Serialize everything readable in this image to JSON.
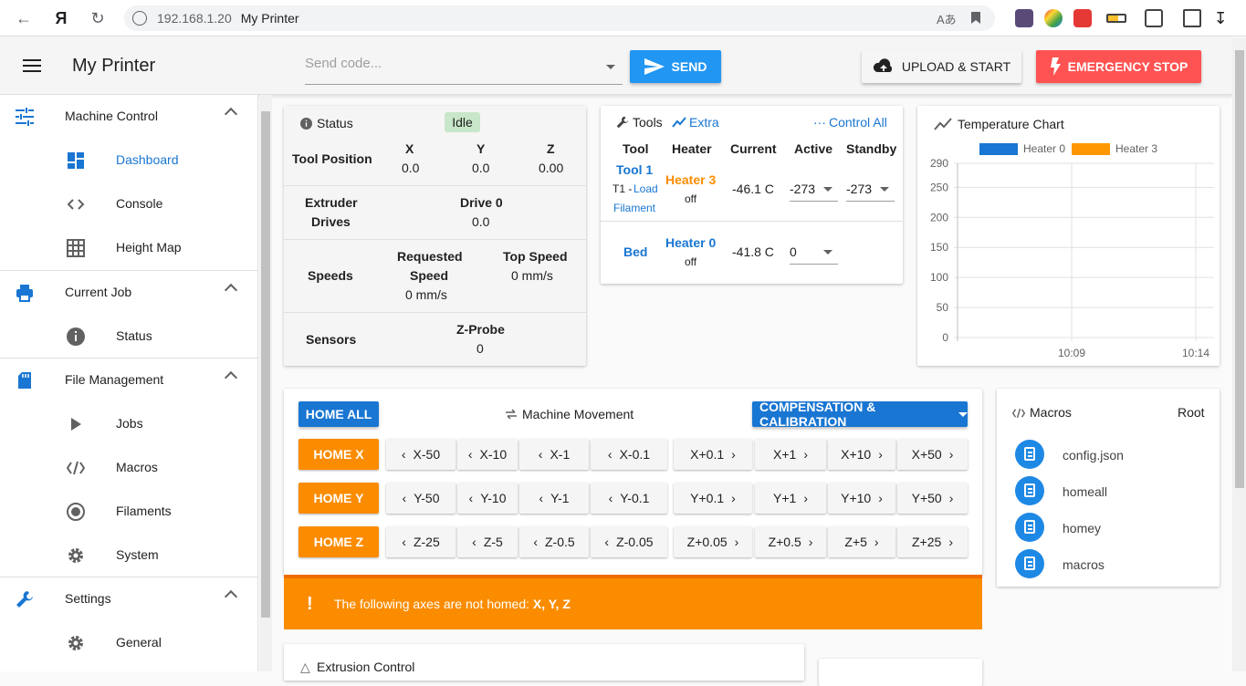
{
  "browser": {
    "host": "192.168.1.20",
    "title": "My Printer"
  },
  "app": {
    "title": "My Printer",
    "send_placeholder": "Send code...",
    "send_label": "SEND",
    "upload_label": "UPLOAD & START",
    "estop_label": "EMERGENCY STOP"
  },
  "sidebar": {
    "machine_control": "Machine Control",
    "dashboard": "Dashboard",
    "console": "Console",
    "height_map": "Height Map",
    "current_job": "Current Job",
    "status": "Status",
    "file_management": "File Management",
    "jobs": "Jobs",
    "macros": "Macros",
    "filaments": "Filaments",
    "system": "System",
    "settings": "Settings",
    "general": "General"
  },
  "status_panel": {
    "title": "Status",
    "state": "Idle",
    "tool_position": "Tool Position",
    "x_label": "X",
    "x_val": "0.0",
    "y_label": "Y",
    "y_val": "0.0",
    "z_label": "Z",
    "z_val": "0.00",
    "extruder_drives": "Extruder Drives",
    "extruder_line1": "Extruder",
    "extruder_line2": "Drives",
    "drive0_label": "Drive 0",
    "drive0_val": "0.0",
    "speeds": "Speeds",
    "requested_line1": "Requested",
    "requested_line2": "Speed",
    "requested_val": "0 mm/s",
    "top_speed": "Top Speed",
    "top_speed_val": "0 mm/s",
    "sensors": "Sensors",
    "zprobe": "Z-Probe",
    "zprobe_val": "0"
  },
  "tools_panel": {
    "title": "Tools",
    "extra": "Extra",
    "control_all": "Control All",
    "col_tool": "Tool",
    "col_heater": "Heater",
    "col_current": "Current",
    "col_active": "Active",
    "col_standby": "Standby",
    "tool1_name": "Tool 1",
    "tool1_prefix": "T1 - ",
    "tool1_load": "Load",
    "tool1_filament": "Filament",
    "tool1_heater": "Heater 3",
    "tool1_heater_state": "off",
    "tool1_current": "-46.1 C",
    "tool1_active": "-273",
    "tool1_standby": "-273",
    "bed_name": "Bed",
    "bed_heater": "Heater 0",
    "bed_heater_state": "off",
    "bed_current": "-41.8 C",
    "bed_active": "0"
  },
  "temp_chart": {
    "title": "Temperature Chart",
    "colors": {
      "heater0": "#1976d2",
      "heater3": "#ff9800"
    }
  },
  "chart_data": {
    "type": "line",
    "title": "Temperature Chart",
    "series": [
      {
        "name": "Heater 0",
        "values": []
      },
      {
        "name": "Heater 3",
        "values": []
      }
    ],
    "yticks": [
      "290",
      "250",
      "200",
      "150",
      "100",
      "50",
      "0"
    ],
    "xticks": [
      "10:09",
      "10:14"
    ],
    "ylim": [
      0,
      290
    ],
    "grid": true,
    "legend": "top"
  },
  "movement": {
    "home_all": "HOME ALL",
    "title": "Machine Movement",
    "compensation": "COMPENSATION & CALIBRATION",
    "home_x": "HOME X",
    "home_y": "HOME Y",
    "home_z": "HOME Z",
    "x_minus": [
      "X-50",
      "X-10",
      "X-1",
      "X-0.1"
    ],
    "x_plus": [
      "X+0.1",
      "X+1",
      "X+10",
      "X+50"
    ],
    "y_minus": [
      "Y-50",
      "Y-10",
      "Y-1",
      "Y-0.1"
    ],
    "y_plus": [
      "Y+0.1",
      "Y+1",
      "Y+10",
      "Y+50"
    ],
    "z_minus": [
      "Z-25",
      "Z-5",
      "Z-0.5",
      "Z-0.05"
    ],
    "z_plus": [
      "Z+0.05",
      "Z+0.5",
      "Z+5",
      "Z+25"
    ],
    "warning_prefix": "The following axes are not homed: ",
    "warning_axes": "X, Y, Z"
  },
  "macros": {
    "title": "Macros",
    "root": "Root",
    "items": [
      "config.json",
      "homeall",
      "homey",
      "macros"
    ]
  },
  "extrusion": {
    "title": "Extrusion Control"
  }
}
